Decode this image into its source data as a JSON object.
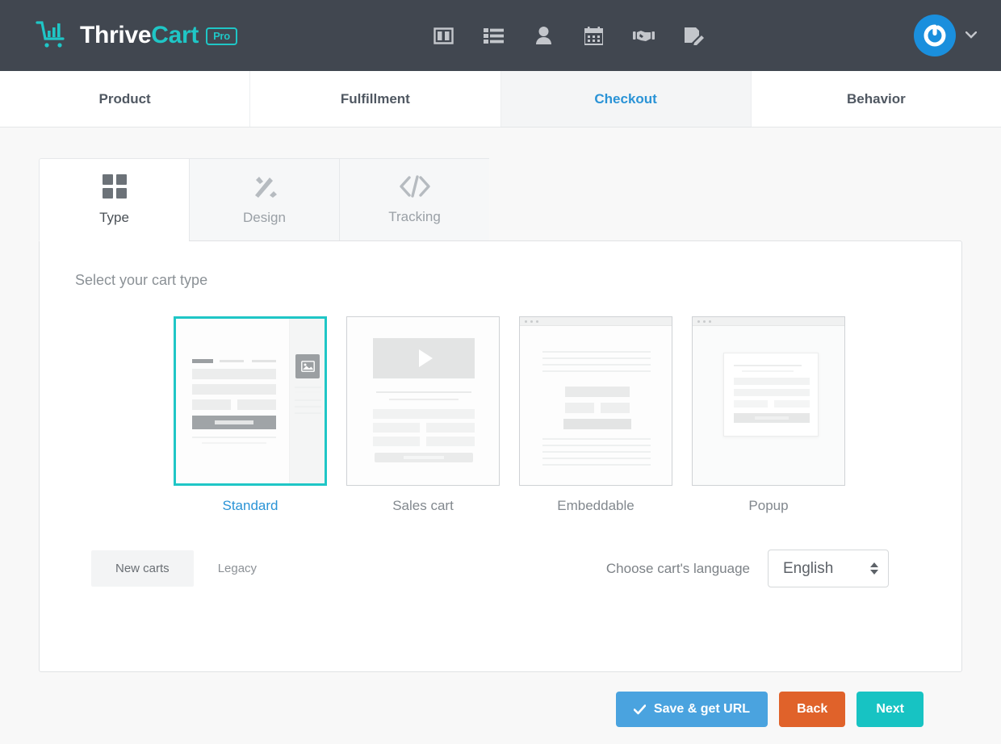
{
  "header": {
    "brand_primary": "Thrive",
    "brand_secondary": "Cart",
    "plan_badge": "Pro",
    "logo_icon": "cart-bars-logo",
    "nav_icons": [
      {
        "name": "dashboard-columns-icon",
        "label": "Dashboard"
      },
      {
        "name": "list-icon",
        "label": "Products"
      },
      {
        "name": "person-icon",
        "label": "Customers"
      },
      {
        "name": "calendar-icon",
        "label": "Calendar"
      },
      {
        "name": "handshake-icon",
        "label": "Affiliates"
      },
      {
        "name": "document-edit-icon",
        "label": "Reports"
      }
    ],
    "avatar_icon": "power-circle-avatar",
    "avatar_caret_icon": "chevron-down-icon",
    "accent_teal": "#1fc6c6",
    "bar_color": "#414750"
  },
  "main_tabs": [
    {
      "label": "Product",
      "active": false
    },
    {
      "label": "Fulfillment",
      "active": false
    },
    {
      "label": "Checkout",
      "active": true
    },
    {
      "label": "Behavior",
      "active": false
    }
  ],
  "sub_tabs": [
    {
      "label": "Type",
      "icon": "grid-squares-icon",
      "active": true
    },
    {
      "label": "Design",
      "icon": "brush-pencil-icon",
      "active": false
    },
    {
      "label": "Tracking",
      "icon": "code-brackets-icon",
      "active": false
    }
  ],
  "panel": {
    "section_title": "Select your cart type",
    "cart_types": [
      {
        "label": "Standard",
        "thumb": "standard",
        "selected": true
      },
      {
        "label": "Sales cart",
        "thumb": "sales",
        "selected": false
      },
      {
        "label": "Embeddable",
        "thumb": "embeddable",
        "selected": false
      },
      {
        "label": "Popup",
        "thumb": "popup",
        "selected": false
      }
    ],
    "segments": [
      {
        "label": "New carts",
        "active": true
      },
      {
        "label": "Legacy",
        "active": false
      }
    ],
    "language": {
      "label": "Choose cart's language",
      "value": "English",
      "spinner_icon": "spinner-up-down-icon"
    }
  },
  "actions": {
    "save_label": "Save & get URL",
    "save_icon": "check-icon",
    "back_label": "Back",
    "next_label": "Next",
    "save_color": "#4aa3df",
    "back_color": "#e0622a",
    "next_color": "#17c3c3"
  }
}
